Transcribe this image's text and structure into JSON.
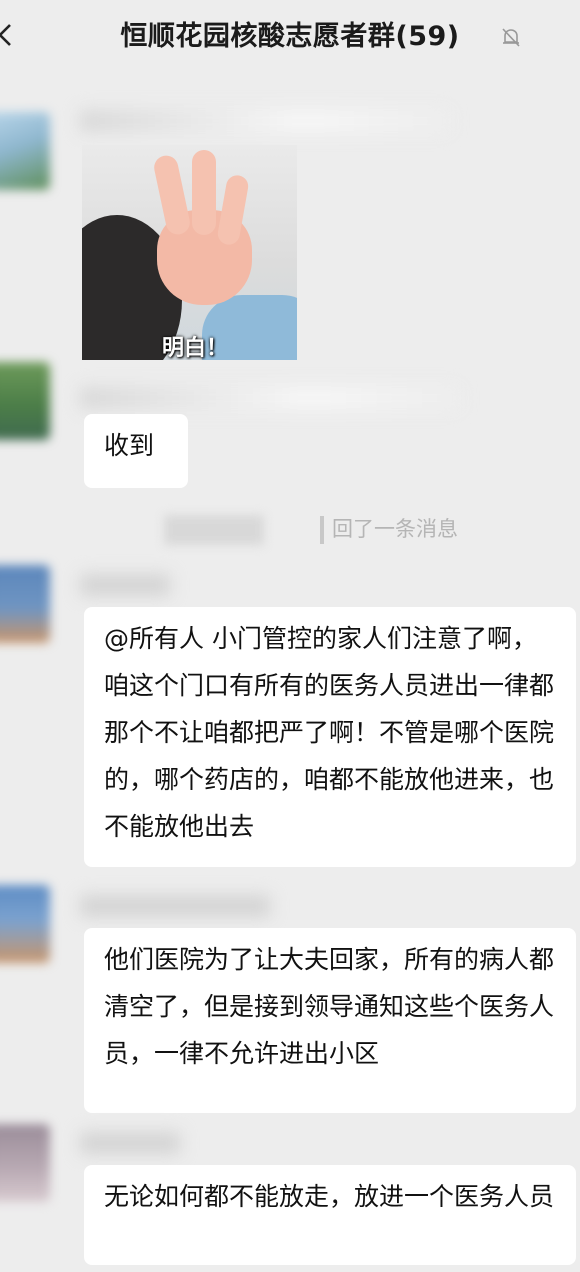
{
  "chat": {
    "title": "恒顺花园核酸志愿者群(59)"
  },
  "messages": {
    "image_sticker_caption": "明白！",
    "received_reply": "收到",
    "quote_notice": "回了一条消息",
    "announcement": "@所有人  小门管控的家人们注意了啊，咱这个门口有所有的医务人员进出一律都那个不让咱都把严了啊！不管是哪个医院的，哪个药店的，咱都不能放他进来，也不能放他出去",
    "hospital_notice": "他们医院为了让大夫回家，所有的病人都清空了，但是接到领导通知这些个医务人员，一律不允许进出小区",
    "final_warning": "无论如何都不能放走，放进一个医务人员"
  }
}
